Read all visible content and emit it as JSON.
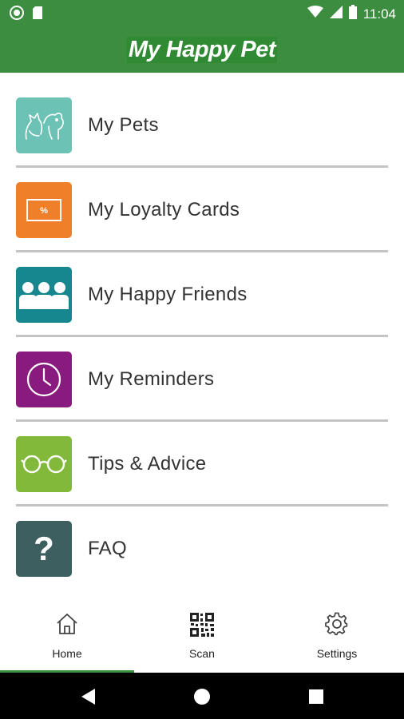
{
  "status_bar": {
    "time": "11:04"
  },
  "app_bar": {
    "title": "My Happy Pet"
  },
  "menu": {
    "items": [
      {
        "label": "My Pets",
        "icon": "pets-icon",
        "color": "#6cc2b4"
      },
      {
        "label": "My Loyalty Cards",
        "icon": "loyalty-card-icon",
        "color": "#f07f2a",
        "card_text": "%"
      },
      {
        "label": "My Happy Friends",
        "icon": "friends-icon",
        "color": "#16878f"
      },
      {
        "label": "My Reminders",
        "icon": "clock-icon",
        "color": "#8a1b7e"
      },
      {
        "label": "Tips & Advice",
        "icon": "glasses-icon",
        "color": "#82b93b"
      },
      {
        "label": "FAQ",
        "icon": "question-icon",
        "color": "#3e5f60",
        "icon_text": "?"
      }
    ]
  },
  "bottom_nav": {
    "items": [
      {
        "label": "Home",
        "icon": "home-icon"
      },
      {
        "label": "Scan",
        "icon": "qr-code-icon"
      },
      {
        "label": "Settings",
        "icon": "gear-icon"
      }
    ],
    "active": "Home",
    "accent": "#3c8d3f"
  }
}
